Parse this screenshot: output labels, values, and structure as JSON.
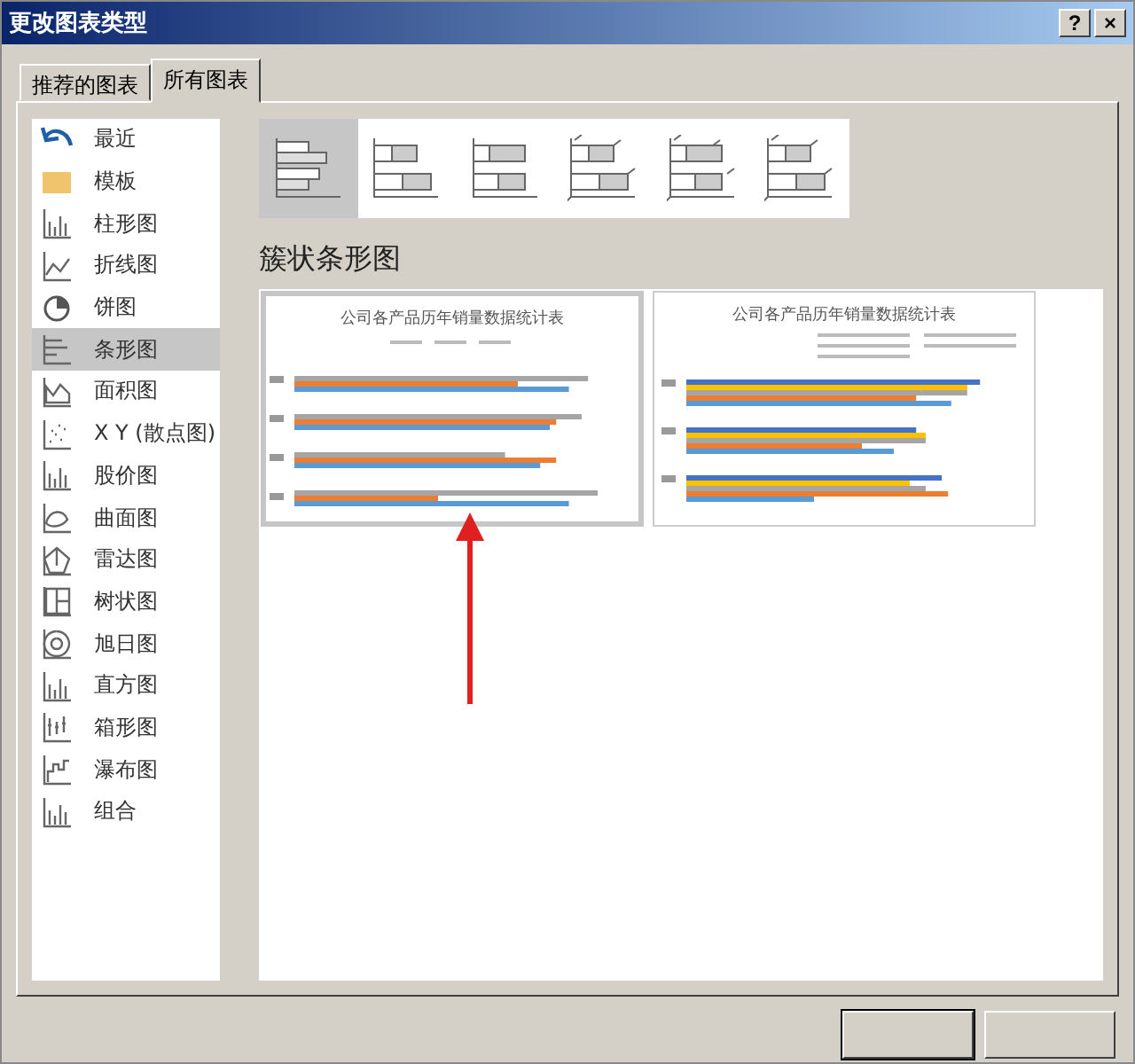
{
  "window": {
    "title": "更改图表类型",
    "help": "?",
    "close": "×"
  },
  "tabs": [
    {
      "label": "推荐的图表",
      "selected": false
    },
    {
      "label": "所有图表",
      "selected": true
    }
  ],
  "categories": [
    {
      "label": "最近",
      "selected": false
    },
    {
      "label": "模板",
      "selected": false
    },
    {
      "label": "柱形图",
      "selected": false
    },
    {
      "label": "折线图",
      "selected": false
    },
    {
      "label": "饼图",
      "selected": false
    },
    {
      "label": "条形图",
      "selected": true
    },
    {
      "label": "面积图",
      "selected": false
    },
    {
      "label": "X Y (散点图)",
      "selected": false
    },
    {
      "label": "股价图",
      "selected": false
    },
    {
      "label": "曲面图",
      "selected": false
    },
    {
      "label": "雷达图",
      "selected": false
    },
    {
      "label": "树状图",
      "selected": false
    },
    {
      "label": "旭日图",
      "selected": false
    },
    {
      "label": "直方图",
      "selected": false
    },
    {
      "label": "箱形图",
      "selected": false
    },
    {
      "label": "瀑布图",
      "selected": false
    },
    {
      "label": "组合",
      "selected": false
    }
  ],
  "subtypes": [
    {
      "selected": true
    },
    {
      "selected": false
    },
    {
      "selected": false
    },
    {
      "selected": false
    },
    {
      "selected": false
    },
    {
      "selected": false
    }
  ],
  "subtype_heading": "簇状条形图",
  "previews": [
    {
      "title": "公司各产品历年销量数据统计表",
      "selected": true
    },
    {
      "title": "公司各产品历年销量数据统计表",
      "selected": false
    }
  ]
}
